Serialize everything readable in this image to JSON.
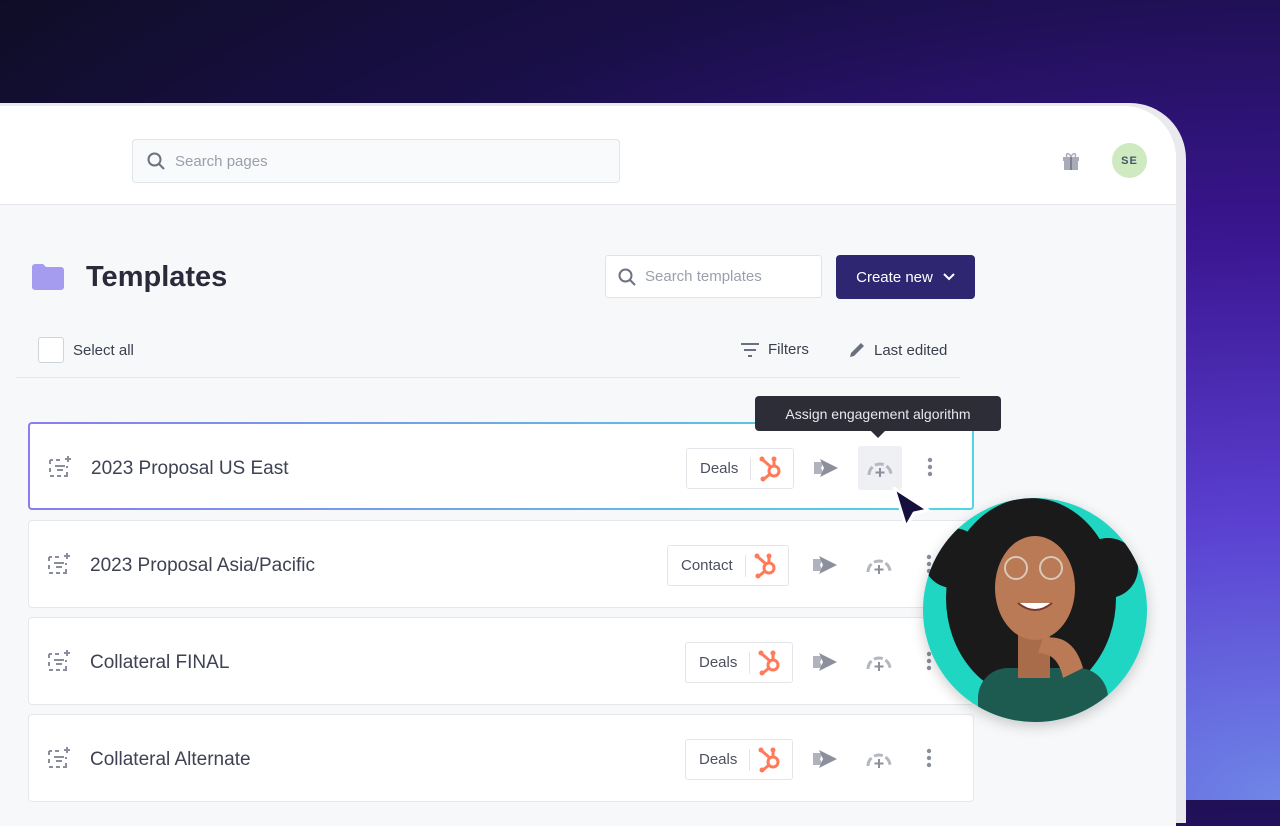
{
  "header": {
    "search_placeholder": "Search pages",
    "avatar_initials": "SE"
  },
  "page": {
    "title": "Templates",
    "search_placeholder": "Search templates",
    "create_new": "Create new"
  },
  "toolbar": {
    "select_all": "Select all",
    "filters": "Filters",
    "sort": "Last edited"
  },
  "tooltip": "Assign engagement algorithm",
  "rows": [
    {
      "name": "2023 Proposal US East",
      "tag": "Deals"
    },
    {
      "name": "2023 Proposal Asia/Pacific",
      "tag": "Contact"
    },
    {
      "name": "Collateral FINAL",
      "tag": "Deals"
    },
    {
      "name": "Collateral Alternate",
      "tag": "Deals"
    }
  ],
  "colors": {
    "primary": "#2e2670",
    "hubspot": "#ff7a59",
    "avatar_bg": "#cfe9c0",
    "photo_bg": "#1fd6c2"
  }
}
